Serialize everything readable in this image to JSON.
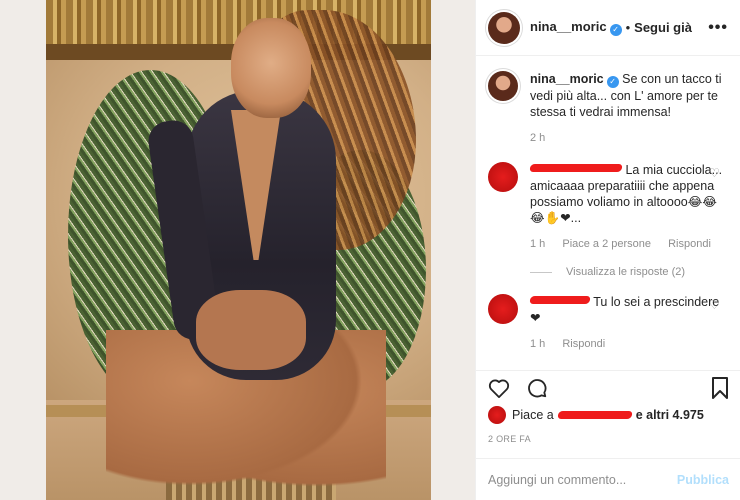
{
  "post": {
    "username": "nina__moric",
    "follow_label": "Segui già",
    "more_icon": "•••"
  },
  "caption": {
    "username": "nina__moric",
    "text": "Se con un tacco ti vedi più alta... con L' amore per te stessa ti vedrai immensa!",
    "time": "2 h"
  },
  "comments": [
    {
      "text": "La mia cucciola... amicaaaa preparatiiii che appena possiamo voliamo in altoooo😂😂😂✋❤...",
      "time": "1 h",
      "likes": "Piace a 2 persone",
      "reply": "Rispondi"
    },
    {
      "text": "Tu lo sei a prescindere❤",
      "time": "1 h",
      "reply": "Rispondi"
    }
  ],
  "view_replies": "Visualizza le risposte (2)",
  "likes": {
    "prefix": "Piace a",
    "suffix": "e altri 4.975"
  },
  "timestamp": "2 ORE FA",
  "add_comment": {
    "placeholder": "Aggiungi un commento...",
    "post_label": "Pubblica"
  },
  "icons": {
    "like": "heart-icon",
    "comment": "comment-icon",
    "save": "bookmark-icon",
    "verified": "verified-badge-icon"
  },
  "colors": {
    "accent": "#3897f0",
    "muted": "#8e8e8e",
    "redaction": "#ef1c1c"
  }
}
